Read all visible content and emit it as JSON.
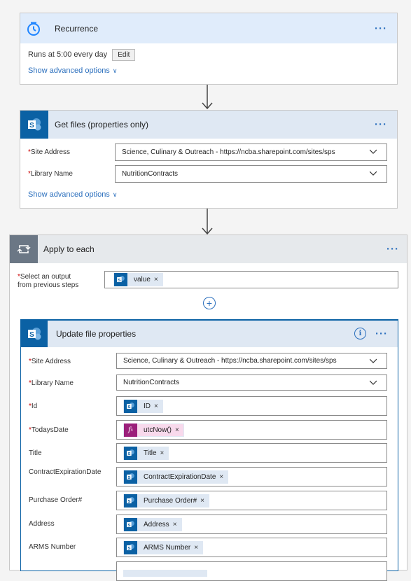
{
  "recurrence": {
    "title": "Recurrence",
    "runs_text": "Runs at 5:00 every day",
    "edit_label": "Edit",
    "advanced": "Show advanced options"
  },
  "getfiles": {
    "title": "Get files (properties only)",
    "site_label": "Site Address",
    "site_value": "Science, Culinary & Outreach - https://ncba.sharepoint.com/sites/sps",
    "library_label": "Library Name",
    "library_value": "NutritionContracts",
    "advanced": "Show advanced options"
  },
  "apply": {
    "title": "Apply to each",
    "select_label_1": "Select an output",
    "select_label_2": "from previous steps",
    "token": "value"
  },
  "update": {
    "title": "Update file properties",
    "site_label": "Site Address",
    "site_value": "Science, Culinary & Outreach - https://ncba.sharepoint.com/sites/sps",
    "library_label": "Library Name",
    "library_value": "NutritionContracts",
    "fields": [
      {
        "label": "Id",
        "required": true,
        "token": "ID"
      },
      {
        "label": "TodaysDate",
        "required": true,
        "token": "utcNow()"
      },
      {
        "label": "Title",
        "required": false,
        "token": "Title"
      },
      {
        "label": "ContractExpirationDate",
        "required": false,
        "token": "ContractExpirationDate"
      },
      {
        "label": "Purchase Order#",
        "required": false,
        "token": "Purchase Order#"
      },
      {
        "label": "Address",
        "required": false,
        "token": "Address"
      },
      {
        "label": "ARMS Number",
        "required": false,
        "token": "ARMS Number"
      }
    ]
  },
  "symbols": {
    "required_mark": "*",
    "remove": "×",
    "more": "···",
    "add": "+",
    "info": "i",
    "fx": "f",
    "fx_sub": "x"
  },
  "colors": {
    "recurrence_header": "#e0ecfb",
    "recurrence_icon": "#1f85ff",
    "sharepoint": "#0b61a4",
    "sharepoint_header": "#dfe8f3",
    "apply_header": "#e6e9ec",
    "apply_icon": "#6b7785",
    "link": "#2b6fbd",
    "required": "#cc0000",
    "expression": "#9b1f7a"
  }
}
